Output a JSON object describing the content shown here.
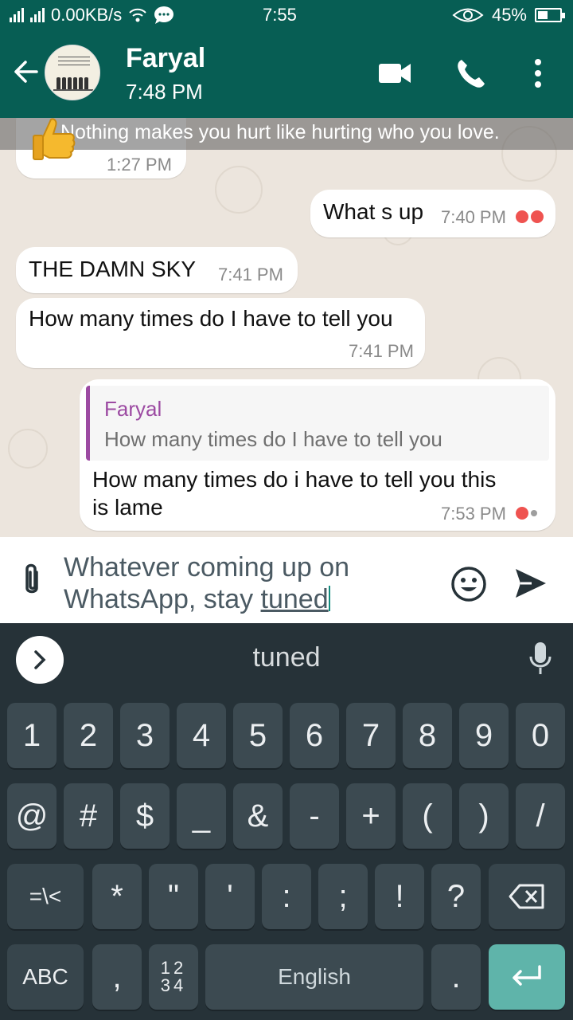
{
  "status_bar": {
    "network_speed": "0.00KB/s",
    "time": "7:55",
    "battery": "45%",
    "battery_level": 0.45,
    "icons": [
      "signal-icon",
      "wifi-icon",
      "chat-bubble-icon",
      "eye-icon",
      "battery-icon"
    ]
  },
  "header": {
    "contact_name": "Faryal",
    "last_seen": "7:48 PM",
    "icons": [
      "back-arrow-icon",
      "video-call-icon",
      "phone-call-icon",
      "more-vert-icon"
    ]
  },
  "chat": {
    "banner_text": "Nothing makes you hurt like hurting who you love.",
    "messages": [
      {
        "type": "incoming",
        "content": "thumbs-up-emoji",
        "time": "1:27 PM"
      },
      {
        "type": "outgoing",
        "text": "What s up",
        "time": "7:40 PM",
        "status": "read"
      },
      {
        "type": "incoming",
        "text": "THE DAMN SKY",
        "time": "7:41 PM"
      },
      {
        "type": "incoming",
        "text": "How many times do I have to tell you",
        "time": "7:41 PM"
      },
      {
        "type": "outgoing",
        "reply_to": {
          "name": "Faryal",
          "text": "How many times do I have to tell you"
        },
        "text_line1": "How many times do i have to tell you this",
        "text_line2": "is lame",
        "time": "7:53 PM",
        "status": "sent"
      }
    ]
  },
  "input": {
    "text_before": "Whatever coming up on WhatsApp, stay ",
    "text_underlined": "tuned",
    "icons": [
      "attach-icon",
      "emoji-icon",
      "send-icon"
    ]
  },
  "keyboard": {
    "suggestion": "tuned",
    "row1": [
      "1",
      "2",
      "3",
      "4",
      "5",
      "6",
      "7",
      "8",
      "9",
      "0"
    ],
    "row2": [
      "@",
      "#",
      "$",
      "_",
      "&",
      "-",
      "+",
      "(",
      ")",
      "/"
    ],
    "row3": [
      "=\\<",
      "*",
      "\"",
      "'",
      ":",
      ";",
      "!",
      "?"
    ],
    "row4": {
      "abc": "ABC",
      "comma": ",",
      "num_top": "12",
      "num_bottom": "34",
      "space": "English",
      "period": "."
    },
    "colors": {
      "background": "#263238",
      "key": "#3c4a51",
      "enter": "#5fb4aa"
    }
  },
  "colors": {
    "header": "#075e54",
    "chat_bg": "#ece5dd",
    "tick_red": "#ef5350",
    "quote_purple": "#9c4aa2"
  }
}
